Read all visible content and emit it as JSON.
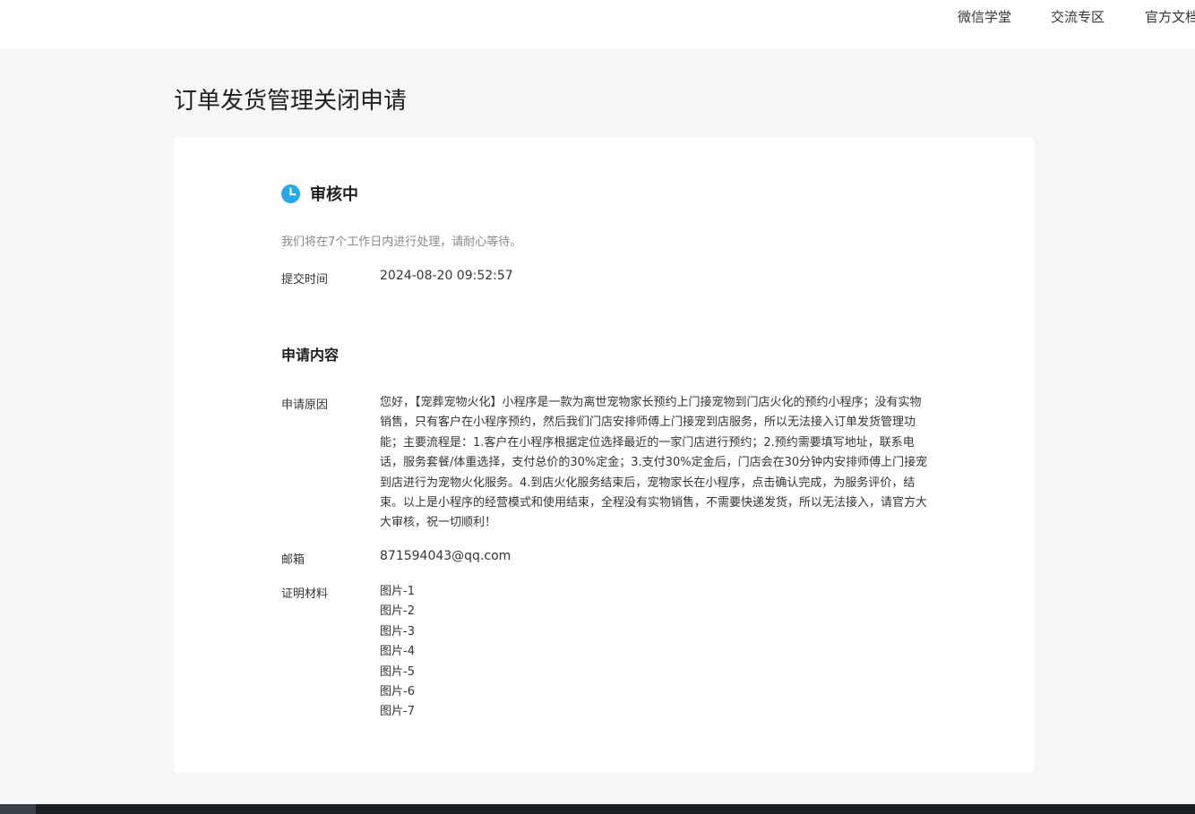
{
  "nav": {
    "links": [
      "微信学堂",
      "交流专区",
      "官方文档"
    ]
  },
  "page": {
    "title": "订单发货管理关闭申请"
  },
  "status": {
    "icon": "clock-icon",
    "label": "审核中",
    "color": "#1aad19",
    "icon_color": "#2aa7e8",
    "notice": "我们将在7个工作日内进行处理，请耐心等待。"
  },
  "submit": {
    "label": "提交时间",
    "value": "2024-08-20 09:52:57"
  },
  "content": {
    "section_title": "申请内容",
    "reason_label": "申请原因",
    "reason_text": "您好，【宠葬宠物火化】小程序是一款为离世宠物家长预约上门接宠物到门店火化的预约小程序；没有实物销售，只有客户在小程序预约，然后我们门店安排师傅上门接宠到店服务，所以无法接入订单发货管理功能；主要流程是：1.客户在小程序根据定位选择最近的一家门店进行预约；2.预约需要填写地址，联系电话，服务套餐/体重选择，支付总价的30%定金；3.支付30%定金后，门店会在30分钟内安排师傅上门接宠到店进行为宠物火化服务。4.到店火化服务结束后，宠物家长在小程序，点击确认完成，为服务评价，结束。以上是小程序的经营模式和使用结束，全程没有实物销售，不需要快递发货，所以无法接入，请官方大大审核，祝一切顺利！",
    "email_label": "邮箱",
    "email_value": "871594043@qq.com",
    "materials_label": "证明材料",
    "materials": [
      "图片-1",
      "图片-2",
      "图片-3",
      "图片-4",
      "图片-5",
      "图片-6",
      "图片-7"
    ]
  }
}
